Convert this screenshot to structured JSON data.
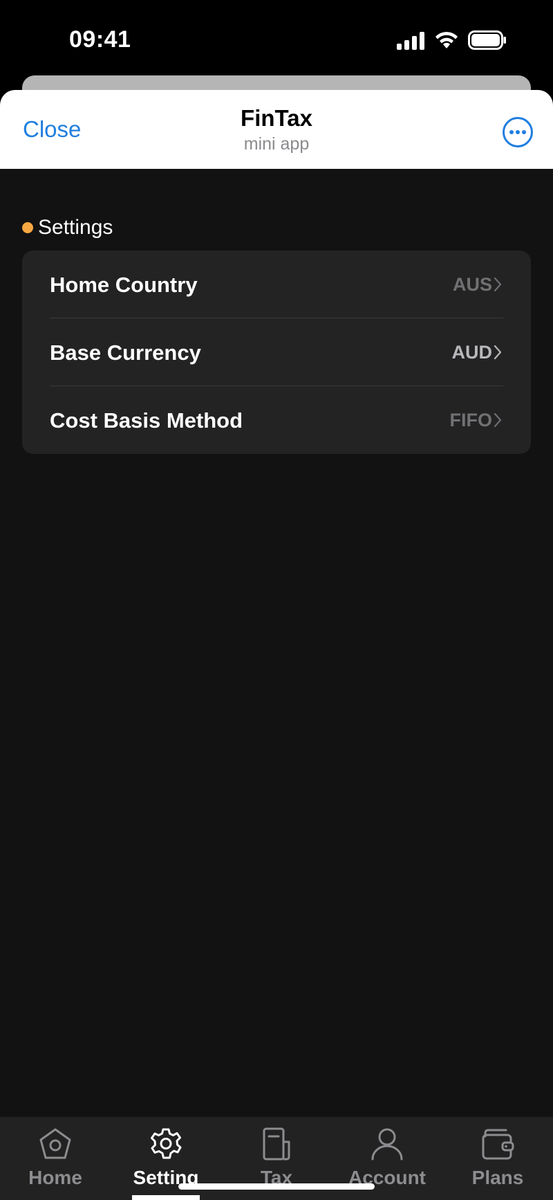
{
  "status_bar": {
    "time": "09:41",
    "icons": [
      "signal-icon",
      "wifi-icon",
      "battery-icon"
    ]
  },
  "header": {
    "close_label": "Close",
    "title": "FinTax",
    "subtitle": "mini app",
    "more_icon": "ellipsis-circle-icon"
  },
  "section": {
    "title": "Settings",
    "dot_color": "#f7a842"
  },
  "settings": [
    {
      "label": "Home Country",
      "value": "AUS"
    },
    {
      "label": "Base Currency",
      "value": "AUD"
    },
    {
      "label": "Cost Basis Method",
      "value": "FIFO"
    }
  ],
  "tabs": [
    {
      "label": "Home",
      "icon": "home-icon",
      "active": false
    },
    {
      "label": "Setting",
      "icon": "gear-icon",
      "active": true
    },
    {
      "label": "Tax",
      "icon": "document-icon",
      "active": false
    },
    {
      "label": "Account",
      "icon": "user-icon",
      "active": false
    },
    {
      "label": "Plans",
      "icon": "wallet-icon",
      "active": false
    }
  ],
  "colors": {
    "accent": "#1f7ee0",
    "background": "#121212",
    "card": "#232324",
    "section_dot": "#f7a842"
  }
}
